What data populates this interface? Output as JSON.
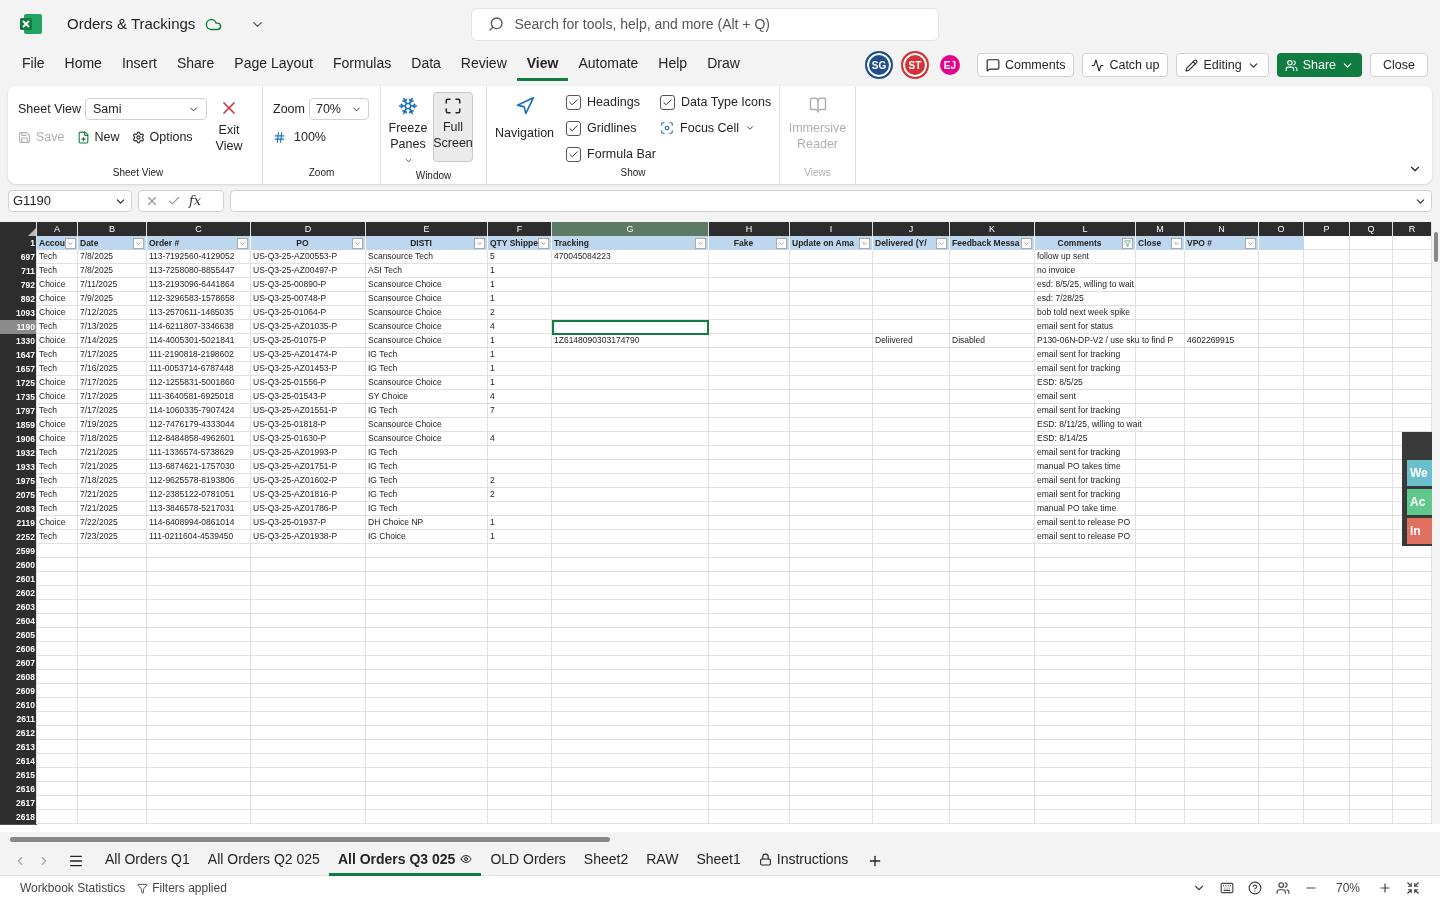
{
  "app": {
    "title": "Orders & Trackings",
    "search": {
      "placeholder": "Search for tools, help, and more (Alt + Q)"
    }
  },
  "menu": [
    {
      "label": "File",
      "selected": false
    },
    {
      "label": "Home",
      "selected": false
    },
    {
      "label": "Insert",
      "selected": false
    },
    {
      "label": "Share",
      "selected": false
    },
    {
      "label": "Page Layout",
      "selected": false
    },
    {
      "label": "Formulas",
      "selected": false
    },
    {
      "label": "Data",
      "selected": false
    },
    {
      "label": "Review",
      "selected": false
    },
    {
      "label": "View",
      "selected": true
    },
    {
      "label": "Automate",
      "selected": false
    },
    {
      "label": "Help",
      "selected": false
    },
    {
      "label": "Draw",
      "selected": false
    }
  ],
  "avatars": [
    {
      "initials": "SG",
      "color": "#1f4e8c"
    },
    {
      "initials": "ST",
      "color": "#d13438"
    },
    {
      "initials": "EJ",
      "color": "#e3008c"
    }
  ],
  "actions": {
    "comments": "Comments",
    "catch_up": "Catch up",
    "editing": "Editing",
    "share": "Share",
    "close": "Close"
  },
  "ribbon": {
    "sheet_view": {
      "label": "Sheet View",
      "value": "Sami",
      "save": {
        "label": "Save",
        "disabled": true
      },
      "new": "New",
      "options": "Options",
      "exit": "Exit View",
      "group": "Sheet View"
    },
    "zoom": {
      "label": "Zoom",
      "value": "70%",
      "reset": "100%",
      "group": "Zoom"
    },
    "window": {
      "freeze": "Freeze Panes",
      "full_screen": {
        "label": "Full Screen",
        "selected": true
      },
      "group": "Window"
    },
    "show": {
      "navigation": "Navigation",
      "checks": [
        {
          "label": "Headings",
          "checked": true
        },
        {
          "label": "Gridlines",
          "checked": true
        },
        {
          "label": "Formula Bar",
          "checked": true
        },
        {
          "label": "Data Type Icons",
          "checked": true
        }
      ],
      "focus_cell": "Focus Cell",
      "group": "Show"
    },
    "views": {
      "reader": {
        "label": "Immersive Reader",
        "disabled": true
      },
      "group": "Views"
    }
  },
  "formula_bar": {
    "name_box": "G1190",
    "fx": "fx"
  },
  "grid": {
    "columns": [
      {
        "letter": "A",
        "selected": false
      },
      {
        "letter": "B",
        "selected": false
      },
      {
        "letter": "C",
        "selected": false
      },
      {
        "letter": "D",
        "selected": false
      },
      {
        "letter": "E",
        "selected": false
      },
      {
        "letter": "F",
        "selected": false
      },
      {
        "letter": "G",
        "selected": true
      },
      {
        "letter": "H",
        "selected": false
      },
      {
        "letter": "I",
        "selected": false
      },
      {
        "letter": "J",
        "selected": false
      },
      {
        "letter": "K",
        "selected": false
      },
      {
        "letter": "L",
        "selected": false
      },
      {
        "letter": "M",
        "selected": false
      },
      {
        "letter": "N",
        "selected": false
      },
      {
        "letter": "O",
        "selected": false
      },
      {
        "letter": "P",
        "selected": false
      },
      {
        "letter": "Q",
        "selected": false
      },
      {
        "letter": "R",
        "selected": false
      }
    ],
    "header_row": {
      "number": "1",
      "cells": [
        {
          "text": "Accou",
          "filtered": false
        },
        {
          "text": "Date",
          "filtered": false
        },
        {
          "text": "Order #",
          "filtered": false
        },
        {
          "text": "PO",
          "filtered": false
        },
        {
          "text": "DISTI",
          "filtered": false
        },
        {
          "text": "QTY Shippe",
          "filtered": false
        },
        {
          "text": "Tracking",
          "filtered": false
        },
        {
          "text": "Fake",
          "filtered": false
        },
        {
          "text": "Update on Ama",
          "filtered": false
        },
        {
          "text": "Delivered (Y/",
          "filtered": false
        },
        {
          "text": "Feedback Messa",
          "filtered": false
        },
        {
          "text": "Comments",
          "filtered": true
        },
        {
          "text": "Close",
          "filtered": false
        },
        {
          "text": "VPO #",
          "filtered": false
        }
      ]
    },
    "rows": [
      {
        "number": "697",
        "selected": false,
        "cells": {
          "A": "Tech",
          "B": "7/8/2025",
          "C": "113-7192560-4129052",
          "D": "US-Q3-25-AZ00553-P",
          "E": "Scansource Tech",
          "F": "5",
          "G": "470045084223",
          "L": "follow up sent"
        }
      },
      {
        "number": "711",
        "selected": false,
        "cells": {
          "A": "Tech",
          "B": "7/8/2025",
          "C": "113-7258080-8855447",
          "D": "US-Q3-25-AZ00497-P",
          "E": "ASI Tech",
          "F": "1",
          "L": "no invoice"
        }
      },
      {
        "number": "792",
        "selected": false,
        "cells": {
          "A": "Choice",
          "B": "7/11/2025",
          "C": "113-2193096-6441864",
          "D": "US-Q3-25-00890-P",
          "E": "Scansource Choice",
          "F": "1",
          "L": "esd: 8/5/25, willing to wait"
        }
      },
      {
        "number": "892",
        "selected": false,
        "cells": {
          "A": "Choice",
          "B": "7/9/2025",
          "C": "112-3296583-1578658",
          "D": "US-Q3-25-00748-P",
          "E": "Scansource Choice",
          "F": "1",
          "L": "esd: 7/28/25"
        }
      },
      {
        "number": "1093",
        "selected": false,
        "cells": {
          "A": "Choice",
          "B": "7/12/2025",
          "C": "113-2570611-1465035",
          "D": "US-Q3-25-01064-P",
          "E": "Scansource Choice",
          "F": "2",
          "L": "bob told next week spike"
        }
      },
      {
        "number": "1190",
        "selected": true,
        "cells": {
          "A": "Tech",
          "B": "7/13/2025",
          "C": "114-6211807-3346638",
          "D": "US-Q3-25-AZ01035-P",
          "E": "Scansource Choice",
          "F": "4",
          "L": "email sent for status"
        }
      },
      {
        "number": "1330",
        "selected": false,
        "cells": {
          "A": "Choice",
          "B": "7/14/2025",
          "C": "114-4005301-5021841",
          "D": "US-Q3-25-01075-P",
          "E": "Scansource Choice",
          "F": "1",
          "G": "1Z6148090303174790",
          "J": "Deliivered",
          "K": "Disabled",
          "L": "P130-06N-DP-V2 / use sku to find P",
          "N": "4602269915"
        }
      },
      {
        "number": "1647",
        "selected": false,
        "cells": {
          "A": "Tech",
          "B": "7/17/2025",
          "C": "111-2190818-2198602",
          "D": "US-Q3-25-AZ01474-P",
          "E": "IG Tech",
          "F": "1",
          "L": "email sent for tracking"
        }
      },
      {
        "number": "1657",
        "selected": false,
        "cells": {
          "A": "Tech",
          "B": "7/16/2025",
          "C": "111-0053714-6787448",
          "D": "US-Q3-25-AZ01453-P",
          "E": "IG Tech",
          "F": "1",
          "L": "email sent for tracking"
        }
      },
      {
        "number": "1725",
        "selected": false,
        "cells": {
          "A": "Choice",
          "B": "7/17/2025",
          "C": "112-1255831-5001860",
          "D": "US-Q3-25-01556-P",
          "E": "Scansource Choice",
          "F": "1",
          "L": " ESD:  8/5/25"
        }
      },
      {
        "number": "1735",
        "selected": false,
        "cells": {
          "A": "Choice",
          "B": "7/17/2025",
          "C": "111-3640581-6925018",
          "D": "US-Q3-25-01543-P",
          "E": "SY Choice",
          "F": "4",
          "L": "email sent"
        }
      },
      {
        "number": "1797",
        "selected": false,
        "cells": {
          "A": "Tech",
          "B": "7/17/2025",
          "C": "114-1060335-7907424",
          "D": "US-Q3-25-AZ01551-P",
          "E": "IG Tech",
          "F": "7",
          "L": "email sent for tracking"
        }
      },
      {
        "number": "1859",
        "selected": false,
        "cells": {
          "A": "Choice",
          "B": "7/19/2025",
          "C": "112-7476179-4333044",
          "D": "US-Q3-25-01818-P",
          "E": "Scansource Choice",
          "L": "ESD: 8/11/25, willing to wait"
        }
      },
      {
        "number": "1906",
        "selected": false,
        "cells": {
          "A": "Choice",
          "B": "7/18/2025",
          "C": "112-8484858-4962601",
          "D": "US-Q3-25-01630-P",
          "E": "Scansource Choice",
          "F": "4",
          "L": "ESD: 8/14/25"
        }
      },
      {
        "number": "1932",
        "selected": false,
        "cells": {
          "A": "Tech",
          "B": "7/21/2025",
          "C": "111-1336574-5738629",
          "D": "US-Q3-25-AZ01993-P",
          "E": "IG Tech",
          "L": "email sent for tracking"
        }
      },
      {
        "number": "1933",
        "selected": false,
        "cells": {
          "A": "Tech",
          "B": "7/21/2025",
          "C": "113-6874621-1757030",
          "D": "US-Q3-25-AZ01751-P",
          "E": "IG Tech",
          "L": "manual PO takes time"
        }
      },
      {
        "number": "1975",
        "selected": false,
        "cells": {
          "A": "Tech",
          "B": "7/18/2025",
          "C": "112-9625578-8193806",
          "D": "US-Q3-25-AZ01602-P",
          "E": "IG Tech",
          "F": "2",
          "L": "email sent for tracking"
        }
      },
      {
        "number": "2075",
        "selected": false,
        "cells": {
          "A": "Tech",
          "B": "7/21/2025",
          "C": "112-2385122-0781051",
          "D": "US-Q3-25-AZ01816-P",
          "E": "IG Tech",
          "F": "2",
          "L": "email sent for tracking"
        }
      },
      {
        "number": "2083",
        "selected": false,
        "cells": {
          "A": "Tech",
          "B": "7/21/2025",
          "C": "113-3846578-5217031",
          "D": "US-Q3-25-AZ01786-P",
          "E": "IG Tech",
          "L": "manual PO take time"
        }
      },
      {
        "number": "2119",
        "selected": false,
        "cells": {
          "A": "Choice",
          "B": "7/22/2025",
          "C": "114-6408994-0861014",
          "D": "US-Q3-25-01937-P",
          "E": "DH Choice NP",
          "F": "1",
          "L": "email sent to release PO"
        }
      },
      {
        "number": "2252",
        "selected": false,
        "cells": {
          "A": "Tech",
          "B": "7/23/2025",
          "C": "111-0211604-4539450",
          "D": "US-Q3-25-AZ01938-P",
          "E": "IG Choice",
          "F": "1",
          "L": "email sent to release PO"
        }
      }
    ],
    "empty_rows": [
      "2599",
      "2600",
      "2601",
      "2602",
      "2603",
      "2604",
      "2605",
      "2606",
      "2607",
      "2608",
      "2609",
      "2610",
      "2611",
      "2612",
      "2613",
      "2614",
      "2615",
      "2616",
      "2617",
      "2618"
    ]
  },
  "side_panel": [
    {
      "text": "We",
      "color": "#6bbfca"
    },
    {
      "text": "Ac",
      "color": "#5ec98a"
    },
    {
      "text": "In",
      "color": "#e0705f"
    }
  ],
  "sheets": [
    {
      "label": "All Orders Q1",
      "selected": false,
      "kind": "plain"
    },
    {
      "label": "All Orders Q2 025",
      "selected": false,
      "kind": "plain"
    },
    {
      "label": "All Orders Q3 025",
      "selected": true,
      "kind": "watched"
    },
    {
      "label": "OLD Orders",
      "selected": false,
      "kind": "plain"
    },
    {
      "label": "Sheet2",
      "selected": false,
      "kind": "plain"
    },
    {
      "label": "RAW",
      "selected": false,
      "kind": "plain"
    },
    {
      "label": "Sheet1",
      "selected": false,
      "kind": "plain"
    },
    {
      "label": "Instructions",
      "selected": false,
      "kind": "locked"
    }
  ],
  "status_bar": {
    "stats": "Workbook Statistics",
    "filters": "Filters applied",
    "zoom": "70%"
  }
}
